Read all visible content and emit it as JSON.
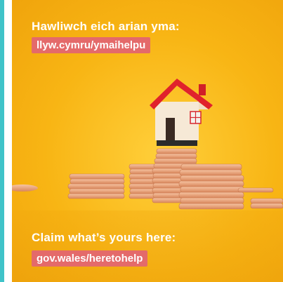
{
  "welsh_heading": "Hawliwch eich arian yma:",
  "welsh_link": "llyw.cymru/ymaihelpu",
  "english_heading": "Claim what’s yours here:",
  "english_link": "gov.wales/heretohelp",
  "colors": {
    "background": "#f8b514",
    "accent_stripe": "#3fc3c9",
    "link_pill": "#e46a6a",
    "roof": "#e0222c",
    "coin": "#f0a57c"
  }
}
